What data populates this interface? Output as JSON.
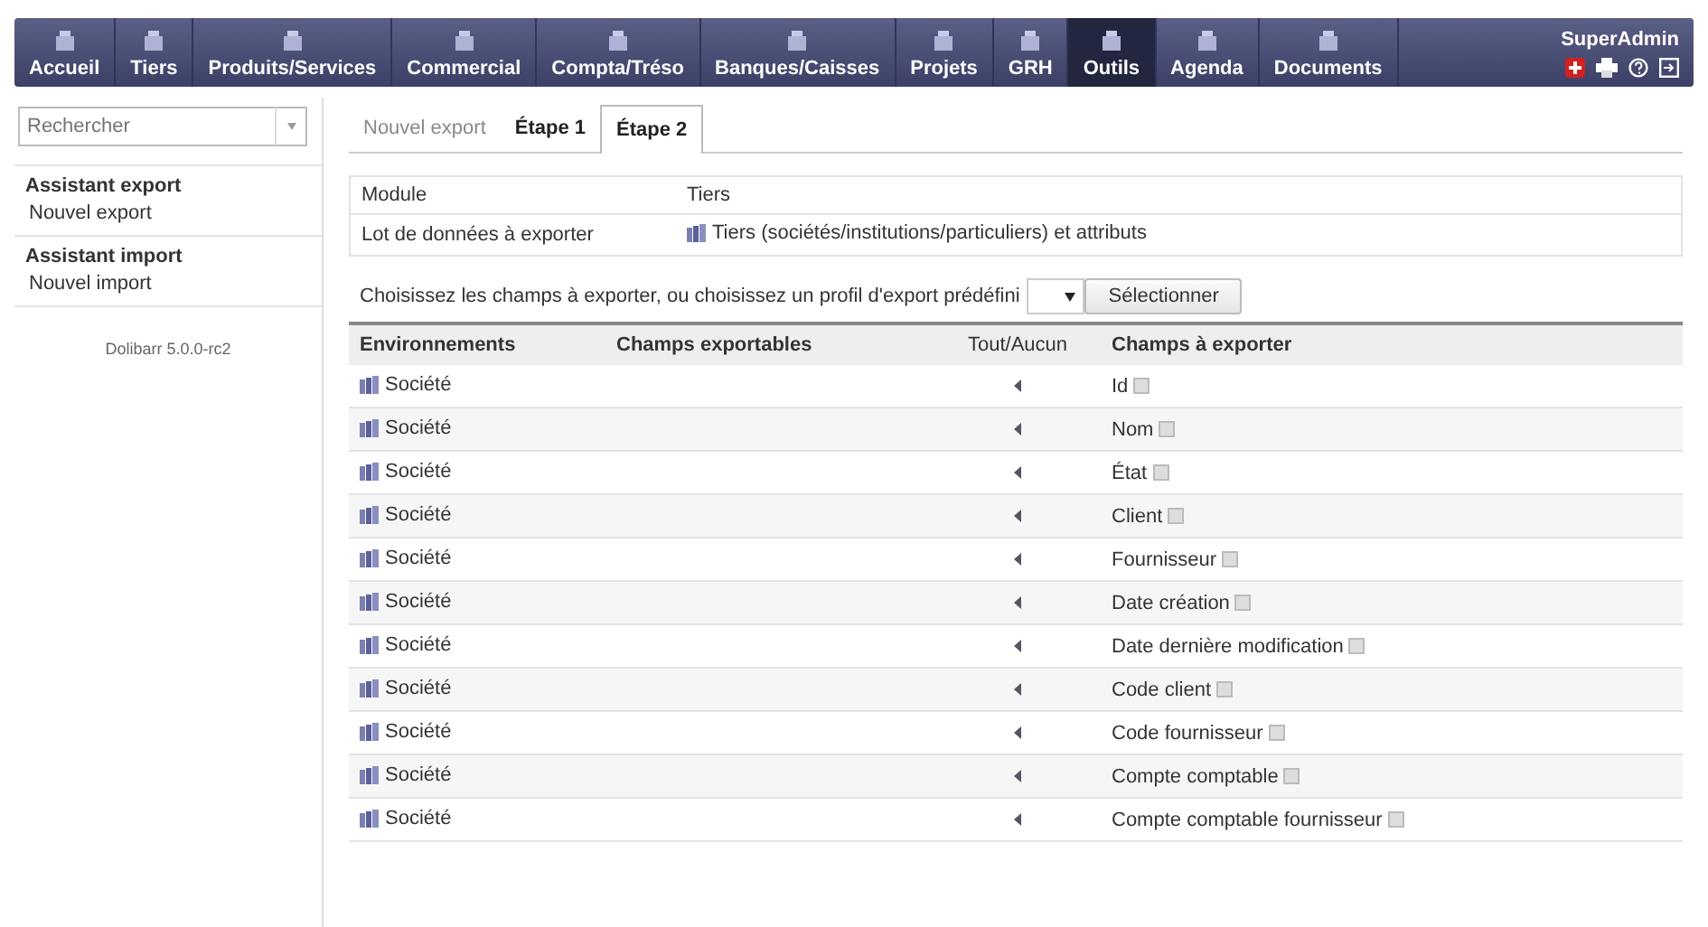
{
  "menu": [
    {
      "label": "Accueil",
      "selected": false
    },
    {
      "label": "Tiers",
      "selected": false
    },
    {
      "label": "Produits/Services",
      "selected": false
    },
    {
      "label": "Commercial",
      "selected": false
    },
    {
      "label": "Compta/Tréso",
      "selected": false
    },
    {
      "label": "Banques/Caisses",
      "selected": false
    },
    {
      "label": "Projets",
      "selected": false
    },
    {
      "label": "GRH",
      "selected": false
    },
    {
      "label": "Outils",
      "selected": true
    },
    {
      "label": "Agenda",
      "selected": false
    },
    {
      "label": "Documents",
      "selected": false
    }
  ],
  "user": {
    "name": "SuperAdmin"
  },
  "sidebar": {
    "search": {
      "placeholder": "Rechercher"
    },
    "sections": [
      {
        "title": "Assistant export",
        "items": [
          "Nouvel export"
        ]
      },
      {
        "title": "Assistant import",
        "items": [
          "Nouvel import"
        ]
      }
    ],
    "version": "Dolibarr 5.0.0-rc2"
  },
  "tabs": [
    {
      "label": "Nouvel export",
      "selected": false
    },
    {
      "label": "Étape 1",
      "selected": false
    },
    {
      "label": "Étape 2",
      "selected": true
    }
  ],
  "info": [
    {
      "label": "Module",
      "value": "Tiers",
      "icon": false
    },
    {
      "label": "Lot de données à exporter",
      "value": "Tiers (sociétés/institutions/particuliers) et attributs",
      "icon": true
    }
  ],
  "profile": {
    "prompt": "Choisissez les champs à exporter, ou choisissez un profil d'export prédéfini",
    "button": "Sélectionner"
  },
  "table": {
    "columns": [
      "Environnements",
      "Champs exportables",
      "Tout/Aucun",
      "Champs à exporter"
    ],
    "rows": [
      {
        "env": "Société",
        "field": "Id"
      },
      {
        "env": "Société",
        "field": "Nom"
      },
      {
        "env": "Société",
        "field": "État"
      },
      {
        "env": "Société",
        "field": "Client"
      },
      {
        "env": "Société",
        "field": "Fournisseur"
      },
      {
        "env": "Société",
        "field": "Date création"
      },
      {
        "env": "Société",
        "field": "Date dernière modification"
      },
      {
        "env": "Société",
        "field": "Code client"
      },
      {
        "env": "Société",
        "field": "Code fournisseur"
      },
      {
        "env": "Société",
        "field": "Compte comptable"
      },
      {
        "env": "Société",
        "field": "Compte comptable fournisseur"
      }
    ]
  }
}
